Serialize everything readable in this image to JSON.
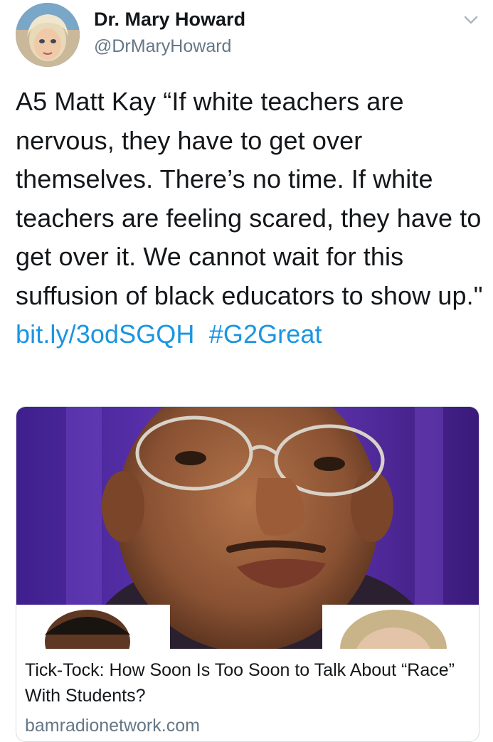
{
  "author": {
    "name": "Dr. Mary Howard",
    "handle": "@DrMaryHoward"
  },
  "tweet": {
    "text": "A5 Matt Kay “If white teachers are nervous, they have to get over themselves. There’s no time. If white teachers are feeling scared, they have to get over it. We cannot wait for this suffusion of black educators to show up.\" ",
    "link": "bit.ly/3odSGQH",
    "hashtag": "#G2Great"
  },
  "card": {
    "title": "Tick-Tock: How Soon Is Too Soon to Talk About “Race” With Students?",
    "domain": "bamradionetwork.com"
  },
  "icons": {
    "menu": "chevron-down-icon"
  },
  "colors": {
    "link": "#1b95e0",
    "secondary_text": "#657786",
    "card_bg_purple": "#5a2fa8"
  }
}
